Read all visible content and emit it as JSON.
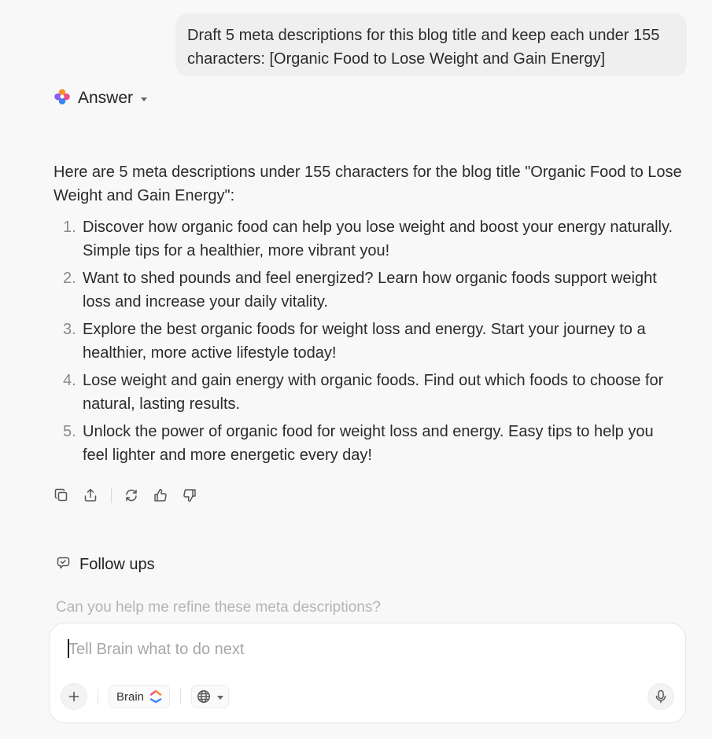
{
  "user_message": {
    "text": "Draft 5 meta descriptions for this blog title and keep each under 155 characters: [Organic Food to Lose Weight and Gain Energy]"
  },
  "answer": {
    "title": "Answer",
    "intro": "Here are 5 meta descriptions under 155 characters for the blog title \"Organic Food to Lose Weight and Gain Energy\":",
    "items": [
      {
        "num": "1.",
        "text": "Discover how organic food can help you lose weight and boost your energy naturally. Simple tips for a healthier, more vibrant you!"
      },
      {
        "num": "2.",
        "text": "Want to shed pounds and feel energized? Learn how organic foods support weight loss and increase your daily vitality."
      },
      {
        "num": "3.",
        "text": "Explore the best organic foods for weight loss and energy. Start your journey to a healthier, more active lifestyle today!"
      },
      {
        "num": "4.",
        "text": "Lose weight and gain energy with organic foods. Find out which foods to choose for natural, lasting results."
      },
      {
        "num": "5.",
        "text": "Unlock the power of organic food for weight loss and energy. Easy tips to help you feel lighter and more energetic every day!"
      }
    ]
  },
  "actions": {
    "icons": [
      "copy-icon",
      "share-icon",
      "regenerate-icon",
      "thumbs-up-icon",
      "thumbs-down-icon"
    ]
  },
  "followups": {
    "title": "Follow ups",
    "items": [
      "Can you help me refine these meta descriptions?"
    ]
  },
  "composer": {
    "placeholder": "Tell Brain what to do next",
    "value": "",
    "brain_label": "Brain"
  },
  "colors": {
    "background": "#f8f8f8",
    "user_bubble": "#efefef",
    "brain_logo_orange": "#f7932e",
    "brain_logo_blue": "#3b82f6",
    "brain_logo_pink": "#ef4d8f"
  }
}
